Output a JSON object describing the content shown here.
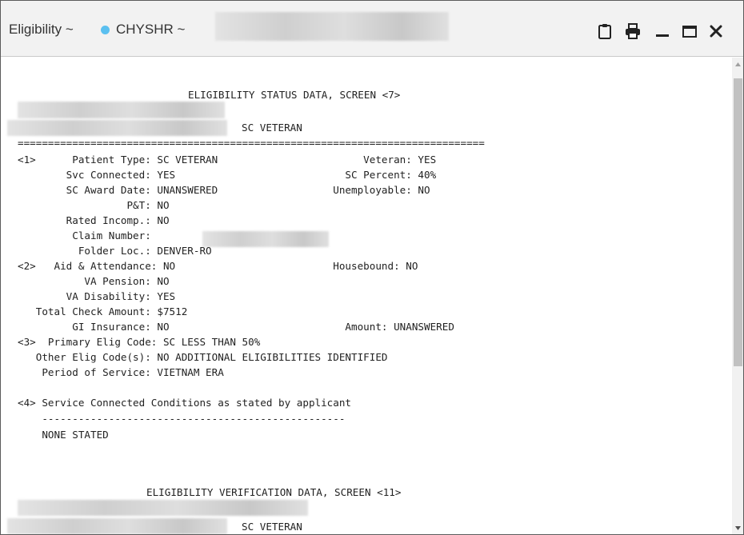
{
  "window": {
    "title_prefix": "Eligibility ~",
    "title_code": "CHYSHR ~",
    "dot_color": "#5bc0f0"
  },
  "toolbar": {
    "clipboard_icon": "clipboard-icon",
    "print_icon": "printer-icon",
    "minimize_icon": "minimize-icon",
    "maximize_icon": "maximize-icon",
    "close_icon": "close-icon"
  },
  "screen7": {
    "header": "ELIGIBILITY STATUS DATA, SCREEN <7>",
    "patient_type_label": "SC VETERAN",
    "separator": "=============================================================================",
    "lines": [
      "<1>      Patient Type: SC VETERAN                        Veteran: YES",
      "        Svc Connected: YES                            SC Percent: 40%",
      "        SC Award Date: UNANSWERED                   Unemployable: NO",
      "                  P&T: NO",
      "        Rated Incomp.: NO",
      "         Claim Number:",
      "          Folder Loc.: DENVER-RO",
      "<2>   Aid & Attendance: NO                          Housebound: NO",
      "           VA Pension: NO",
      "        VA Disability: YES",
      "   Total Check Amount: $7512",
      "         GI Insurance: NO                             Amount: UNANSWERED",
      "<3>  Primary Elig Code: SC LESS THAN 50%",
      "   Other Elig Code(s): NO ADDITIONAL ELIGIBILITIES IDENTIFIED",
      "    Period of Service: VIETNAM ERA",
      "",
      "<4> Service Connected Conditions as stated by applicant",
      "    --------------------------------------------------",
      "    NONE STATED"
    ]
  },
  "screen11": {
    "header": "ELIGIBILITY VERIFICATION DATA, SCREEN <11>",
    "patient_type_label": "SC VETERAN"
  }
}
